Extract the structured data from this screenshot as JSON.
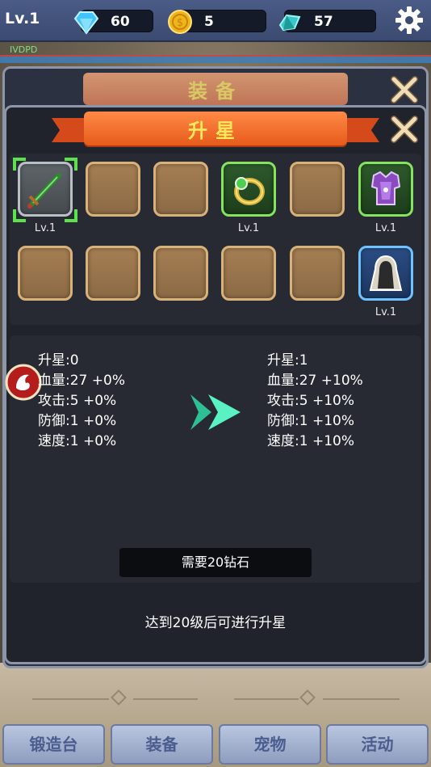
{
  "topbar": {
    "level": "Lv.1",
    "diamonds": "60",
    "coins": "5",
    "gems": "57"
  },
  "hud": {
    "name_tag": "IVDPD"
  },
  "panel_back": {
    "title": "装备"
  },
  "panel_front": {
    "title": "升星"
  },
  "slots": [
    {
      "icon": "sword-icon",
      "level": "Lv.1",
      "selected": true
    },
    {
      "icon": "",
      "level": ""
    },
    {
      "icon": "",
      "level": ""
    },
    {
      "icon": "ring-icon",
      "level": "Lv.1"
    },
    {
      "icon": "",
      "level": ""
    },
    {
      "icon": "armor-icon",
      "level": "Lv.1"
    },
    {
      "icon": "",
      "level": ""
    },
    {
      "icon": "",
      "level": ""
    },
    {
      "icon": "",
      "level": ""
    },
    {
      "icon": "",
      "level": ""
    },
    {
      "icon": "",
      "level": ""
    },
    {
      "icon": "cloak-icon",
      "level": "Lv.1"
    }
  ],
  "stats_current": [
    {
      "label": "升星:",
      "value": "0"
    },
    {
      "label": "血量:",
      "value": "27 +0%"
    },
    {
      "label": "攻击:",
      "value": "5 +0%"
    },
    {
      "label": "防御:",
      "value": "1 +0%"
    },
    {
      "label": "速度:",
      "value": "1 +0%"
    }
  ],
  "stats_next": [
    {
      "label": "升星:",
      "value": "1"
    },
    {
      "label": "血量:",
      "value": "27 +10%"
    },
    {
      "label": "攻击:",
      "value": "5 +10%"
    },
    {
      "label": "防御:",
      "value": "1 +10%"
    },
    {
      "label": "速度:",
      "value": "1 +10%"
    }
  ],
  "cost_label": "需要20钻石",
  "requirement_hint": "达到20级后可进行升星",
  "bottom_tabs": [
    "锻造台",
    "装备",
    "宠物",
    "活动"
  ],
  "colors": {
    "accent_orange": "#e65b1c",
    "title_yellow": "#ffe85a",
    "selection_green": "#5be34d",
    "tab_text": "#4b5d8e"
  }
}
